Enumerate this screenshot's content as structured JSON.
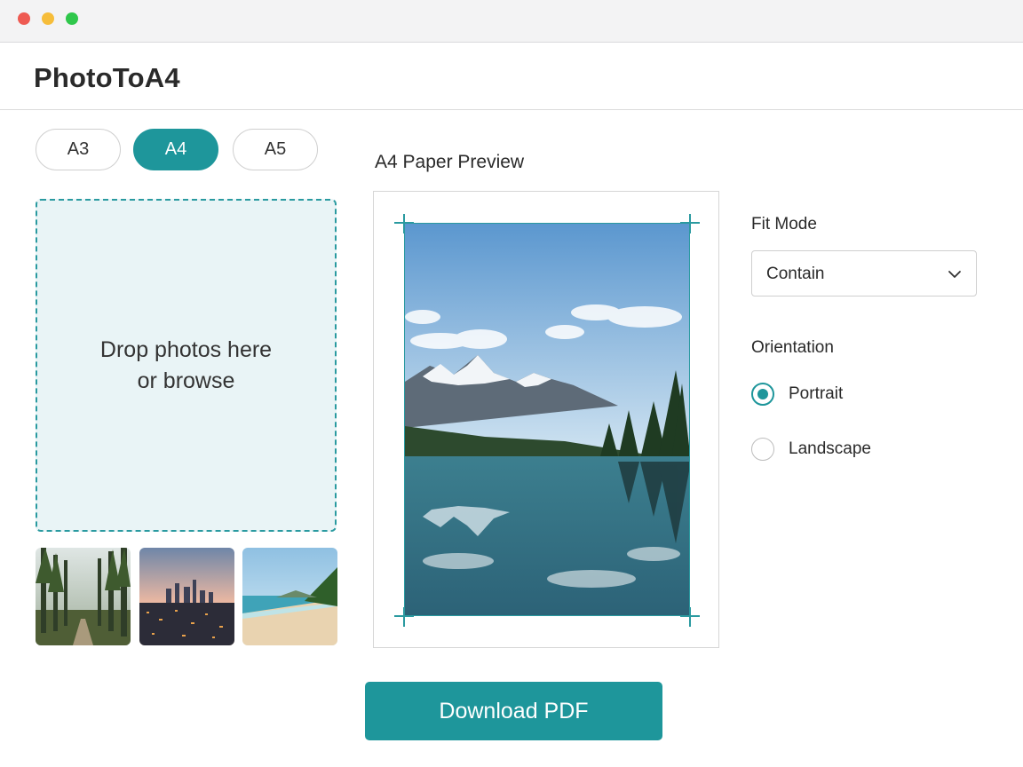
{
  "window": {
    "controls": [
      "close",
      "minimize",
      "maximize"
    ]
  },
  "app": {
    "title": "PhotoToA4"
  },
  "paper_sizes": {
    "options": [
      "A3",
      "A4",
      "A5"
    ],
    "selected": "A4"
  },
  "dropzone": {
    "line1": "Drop photos here",
    "line2": "or browse"
  },
  "thumbnails": [
    "forest path",
    "city skyline at dusk",
    "beach shoreline"
  ],
  "preview": {
    "title": "A4 Paper Preview",
    "image": "mountain lake reflection"
  },
  "fit_mode": {
    "label": "Fit Mode",
    "value": "Contain",
    "icon": "chevron-down-icon"
  },
  "orientation": {
    "label": "Orientation",
    "options": [
      {
        "label": "Portrait",
        "checked": true
      },
      {
        "label": "Landscape",
        "checked": false
      }
    ]
  },
  "actions": {
    "download_label": "Download PDF"
  },
  "colors": {
    "accent": "#1e969b",
    "dropzone_bg": "#e9f4f6"
  }
}
